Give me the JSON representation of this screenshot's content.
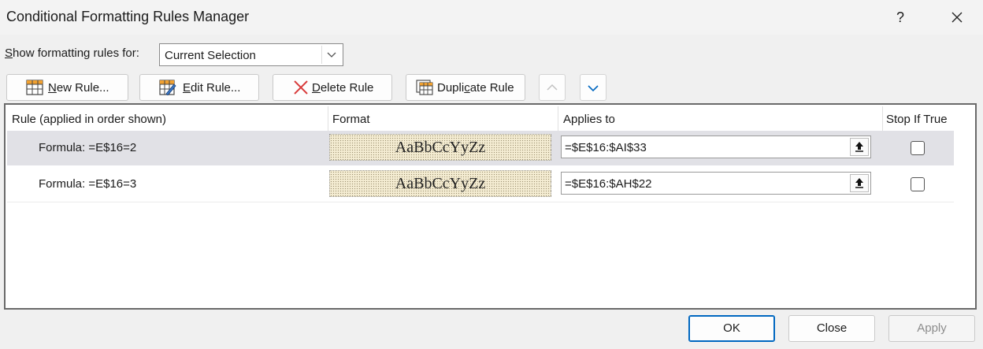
{
  "window": {
    "title": "Conditional Formatting Rules Manager",
    "help_label": "?",
    "close_label": "✕"
  },
  "show_for": {
    "label_prefix": "S",
    "label_rest": "how formatting rules for:",
    "selected": "Current Selection"
  },
  "toolbar": {
    "new_rule": {
      "pre": "",
      "key": "N",
      "post": "ew Rule..."
    },
    "edit_rule": {
      "pre": "",
      "key": "E",
      "post": "dit Rule..."
    },
    "delete_rule": {
      "pre": "",
      "key": "D",
      "post": "elete Rule"
    },
    "duplicate_rule": {
      "pre": "Dupli",
      "key": "c",
      "post": "ate Rule"
    },
    "move_up_enabled": false,
    "move_down_enabled": true
  },
  "table": {
    "headers": [
      "Rule (applied in order shown)",
      "Format",
      "Applies to",
      "Stop If True"
    ],
    "rows": [
      {
        "rule": "Formula: =E$16=2",
        "format_preview": "AaBbCcYyZz",
        "applies_to": "=$E$16:$AI$33",
        "stop_if_true": false,
        "selected": true
      },
      {
        "rule": "Formula: =E$16=3",
        "format_preview": "AaBbCcYyZz",
        "applies_to": "=$E$16:$AH$22",
        "stop_if_true": false,
        "selected": false
      }
    ]
  },
  "buttons": {
    "ok": "OK",
    "close": "Close",
    "apply": "Apply"
  },
  "colors": {
    "accent": "#0067c0",
    "selected_row": "#e1e1e6",
    "format_fill": "#f4ecd2",
    "delete_icon": "#d83b3b"
  }
}
